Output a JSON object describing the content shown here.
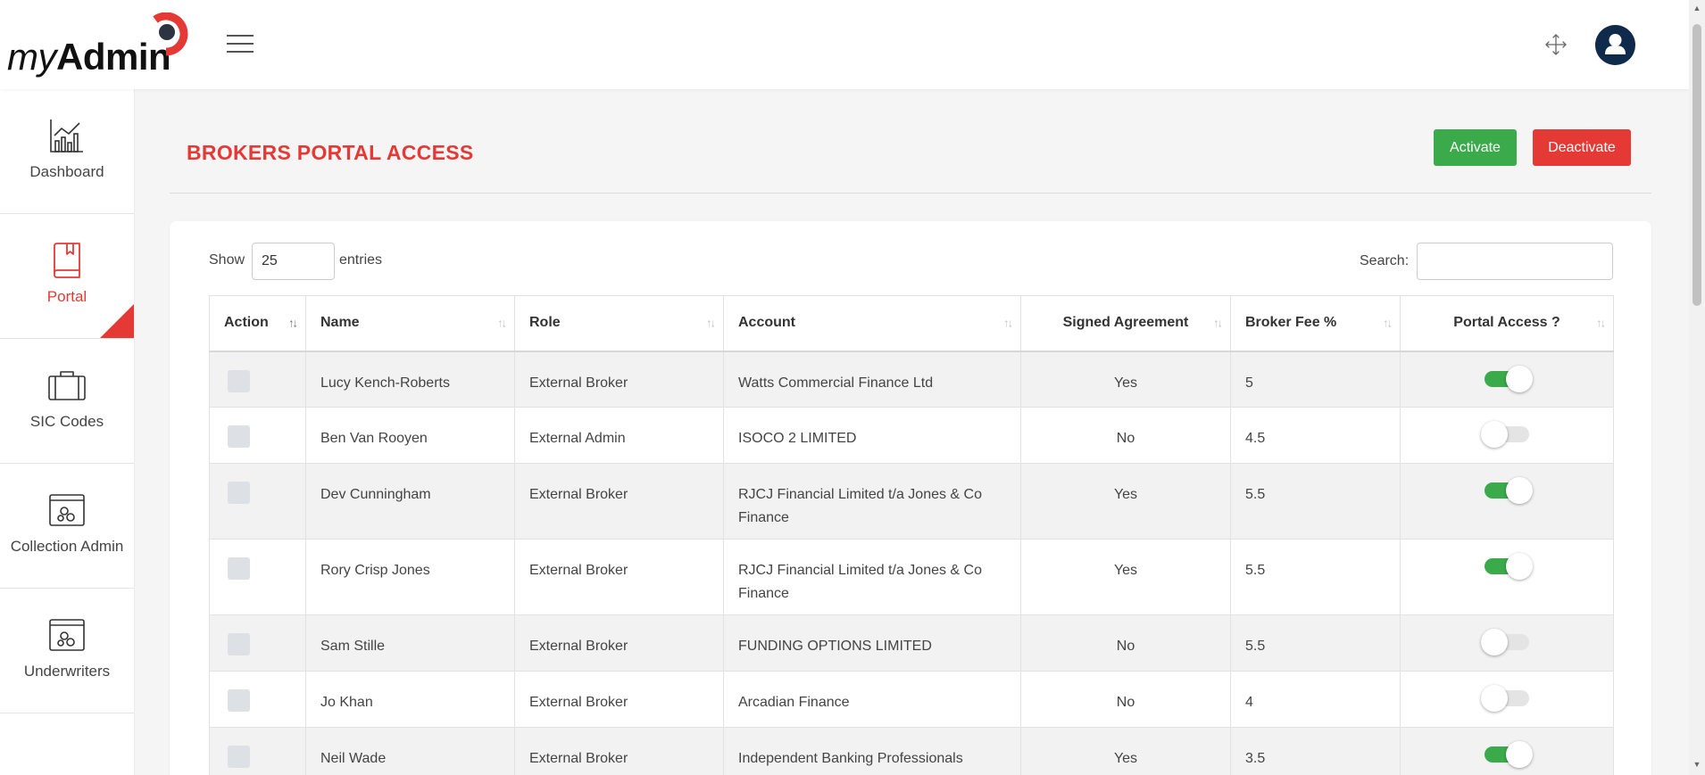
{
  "brand": {
    "logo_my": "my",
    "logo_admin": "Admin",
    "accent": "#e53935"
  },
  "header": {
    "menu_icon": "hamburger-icon",
    "expand_icon": "expand-icon",
    "avatar_icon": "user-icon"
  },
  "sidebar": {
    "items": [
      {
        "label": "Dashboard",
        "icon": "chart-icon",
        "active": false
      },
      {
        "label": "Portal",
        "icon": "book-icon",
        "active": true
      },
      {
        "label": "SIC Codes",
        "icon": "briefcase-icon",
        "active": false
      },
      {
        "label": "Collection Admin",
        "icon": "window-gears-icon",
        "active": false
      },
      {
        "label": "Underwriters",
        "icon": "window-gears-icon",
        "active": false
      }
    ]
  },
  "page": {
    "title": "BROKERS PORTAL ACCESS",
    "activate_label": "Activate",
    "deactivate_label": "Deactivate",
    "activate_color": "#3aaa4a",
    "deactivate_color": "#e53935"
  },
  "table_controls": {
    "show_label": "Show",
    "entries_value": "25",
    "entries_label": "entries",
    "search_label": "Search:",
    "search_value": ""
  },
  "table": {
    "columns": [
      "Action",
      "Name",
      "Role",
      "Account",
      "Signed Agreement",
      "Broker Fee %",
      "Portal Access ?"
    ],
    "rows": [
      {
        "name": "Lucy Kench-Roberts",
        "role": "External Broker",
        "account": "Watts Commercial Finance Ltd",
        "signed": "Yes",
        "fee": "5",
        "portal_access": true
      },
      {
        "name": "Ben Van Rooyen",
        "role": "External Admin",
        "account": "ISOCO 2 LIMITED",
        "signed": "No",
        "fee": "4.5",
        "portal_access": false
      },
      {
        "name": "Dev Cunningham",
        "role": "External Broker",
        "account": "RJCJ Financial Limited t/a Jones & Co Finance",
        "signed": "Yes",
        "fee": "5.5",
        "portal_access": true
      },
      {
        "name": "Rory Crisp Jones",
        "role": "External Broker",
        "account": "RJCJ Financial Limited t/a Jones & Co Finance",
        "signed": "Yes",
        "fee": "5.5",
        "portal_access": true
      },
      {
        "name": "Sam Stille",
        "role": "External Broker",
        "account": "FUNDING OPTIONS LIMITED",
        "signed": "No",
        "fee": "5.5",
        "portal_access": false
      },
      {
        "name": "Jo Khan",
        "role": "External Broker",
        "account": "Arcadian Finance",
        "signed": "No",
        "fee": "4",
        "portal_access": false
      },
      {
        "name": "Neil Wade",
        "role": "External Broker",
        "account": "Independent Banking Professionals Limited",
        "signed": "Yes",
        "fee": "3.5",
        "portal_access": true
      }
    ]
  }
}
